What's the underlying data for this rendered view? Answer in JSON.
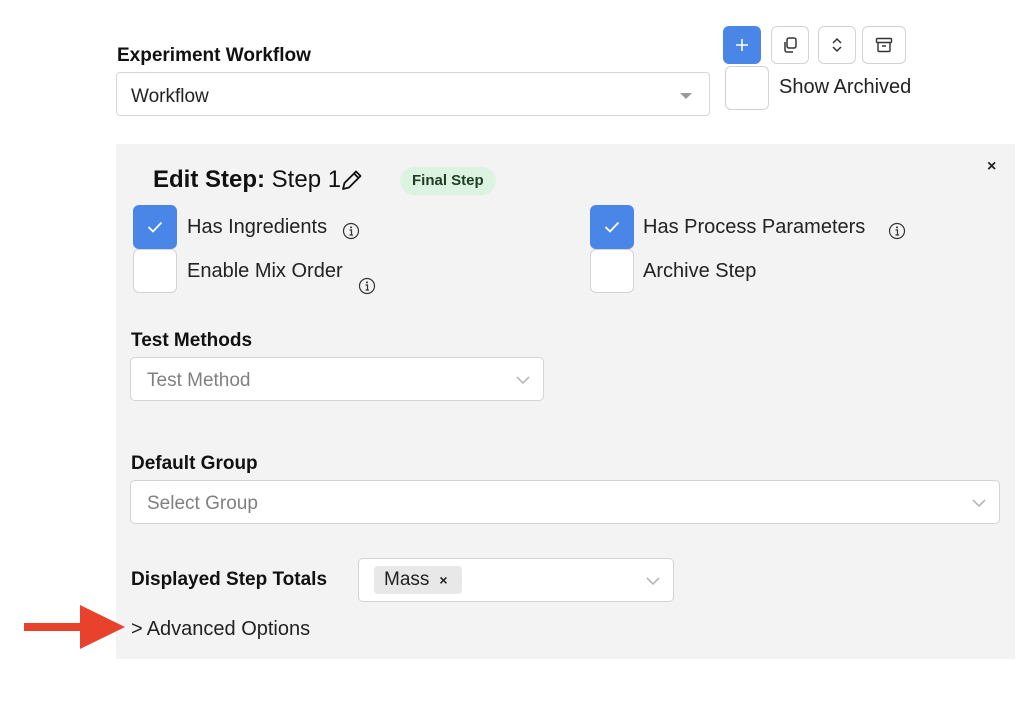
{
  "workflow": {
    "label": "Experiment Workflow",
    "selected": "Workflow",
    "show_archived_label": "Show Archived",
    "show_archived_checked": false
  },
  "toolbar": {
    "add_icon": "plus-icon",
    "copy_icon": "copy-icon",
    "sort_icon": "sort-icon",
    "archive_icon": "archive-icon",
    "accent": "#4a86e8"
  },
  "step": {
    "edit_prefix": "Edit Step:",
    "name": "Step 1",
    "badge": "Final Step",
    "badge_color": "#ddf3e2",
    "close": "×",
    "options": {
      "has_ingredients": {
        "label": "Has Ingredients",
        "checked": true
      },
      "enable_mix_order": {
        "label": "Enable Mix Order",
        "checked": false
      },
      "has_process_parameters": {
        "label": "Has Process Parameters",
        "checked": true
      },
      "archive_step": {
        "label": "Archive Step",
        "checked": false
      }
    },
    "test_methods": {
      "label": "Test Methods",
      "placeholder": "Test Method"
    },
    "default_group": {
      "label": "Default Group",
      "placeholder": "Select Group"
    },
    "displayed_step_totals": {
      "label": "Displayed Step Totals",
      "chips": [
        "Mass"
      ],
      "chip_remove": "×"
    },
    "advanced_options": {
      "chevron": ">",
      "label": "Advanced Options"
    }
  },
  "annotation": {
    "arrow_color": "#e8412c"
  }
}
